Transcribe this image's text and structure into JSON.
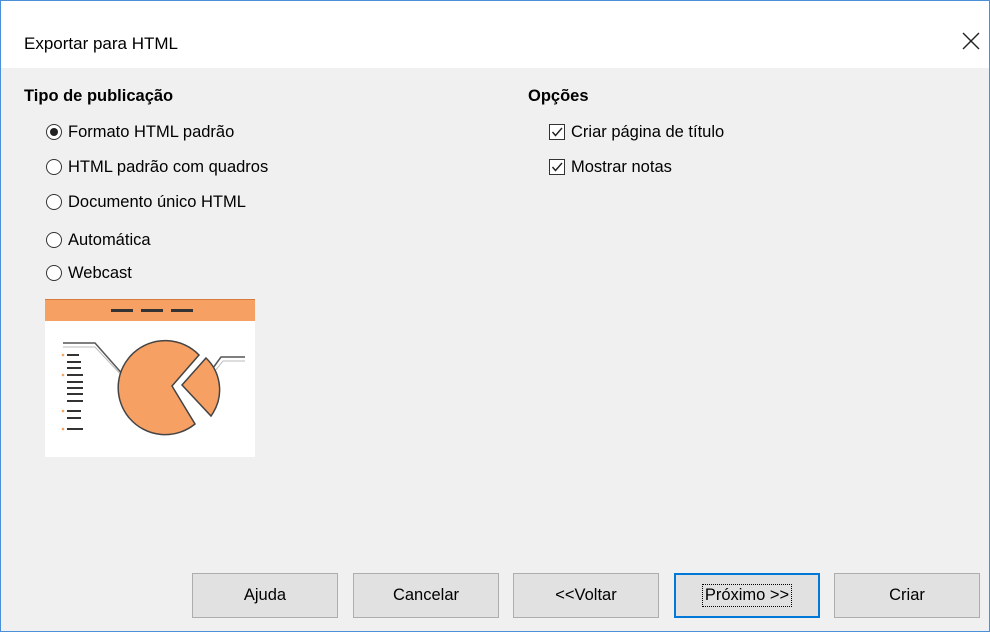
{
  "dialog": {
    "title": "Exportar para HTML"
  },
  "publication_type": {
    "heading": "Tipo de publicação",
    "options": [
      {
        "label": "Formato HTML padrão",
        "selected": true
      },
      {
        "label": "HTML padrão com quadros",
        "selected": false
      },
      {
        "label": "Documento único HTML",
        "selected": false
      },
      {
        "label": "Automática",
        "selected": false
      },
      {
        "label": "Webcast",
        "selected": false
      }
    ]
  },
  "options": {
    "heading": "Opções",
    "items": [
      {
        "label": "Criar página de título",
        "checked": true
      },
      {
        "label": "Mostrar notas",
        "checked": true
      }
    ]
  },
  "buttons": {
    "help": "Ajuda",
    "cancel": "Cancelar",
    "back": "<<Voltar",
    "next": "Próximo >>",
    "create": "Criar"
  },
  "colors": {
    "accent": "#f4a460",
    "preview_bar": "#f7a064",
    "focus_border": "#0078d7"
  }
}
